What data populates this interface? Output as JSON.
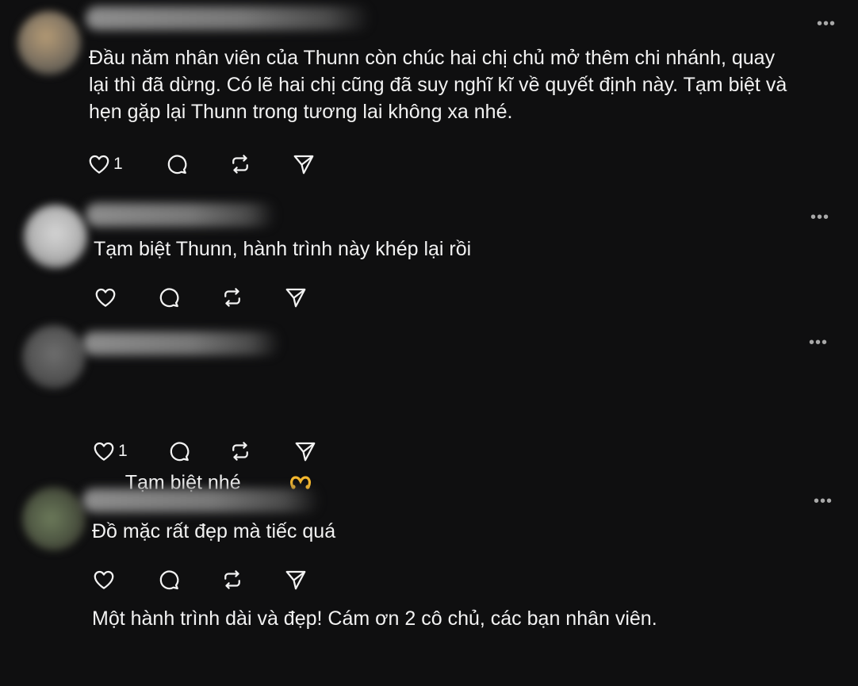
{
  "colors": {
    "background": "#0f0f10",
    "text": "#f2f2f2",
    "muted": "#a8a8a8",
    "emoji_accent": "#f5b82e"
  },
  "icons": {
    "more": "more-dots-icon",
    "like": "heart-icon",
    "reply": "comment-bubble-icon",
    "repost": "repost-icon",
    "share": "send-icon"
  },
  "comments": [
    {
      "more_label": "•••",
      "text": "Đầu năm nhân viên của Thunn còn chúc hai chị chủ mở thêm chi nhánh, quay\nlại thì đã dừng. Có lẽ hai chị cũng đã suy nghĩ kĩ về quyết định này. Tạm biệt và\nhẹn gặp lại Thunn trong tương lai không xa nhé.",
      "like_count": "1"
    },
    {
      "more_label": "•••",
      "text": "Tạm biệt Thunn, hành trình này khép lại rồi",
      "like_count": ""
    },
    {
      "more_label": "•••",
      "text_line1": "Tạm biệt nhé",
      "emoji": "heart-hands-emoji",
      "text_line2": "Một hành trình dài và đẹp! Cám ơn 2 cô chủ, các bạn nhân viên.",
      "like_count": "1"
    },
    {
      "more_label": "•••",
      "text": "Đồ mặc rất đẹp mà tiếc quá",
      "like_count": ""
    }
  ]
}
